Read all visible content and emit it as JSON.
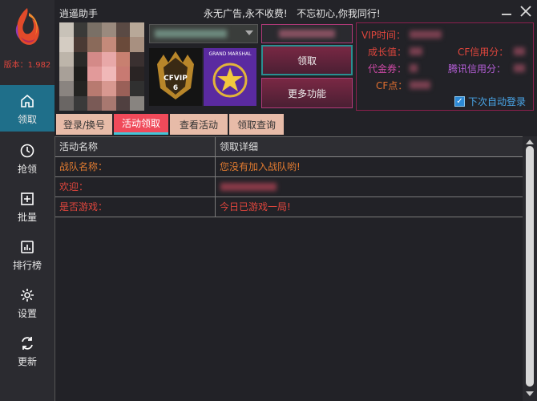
{
  "app": {
    "title": "逍遥助手",
    "slogan": "永无广告,永不收费!   不忘初心,你我同行!",
    "version": "版本：1.982"
  },
  "sidebar": {
    "items": [
      {
        "label": "领取",
        "icon": "home-icon",
        "active": true
      },
      {
        "label": "抢领",
        "icon": "clock-icon"
      },
      {
        "label": "批量",
        "icon": "plus-square-icon"
      },
      {
        "label": "排行榜",
        "icon": "bar-chart-icon"
      },
      {
        "label": "设置",
        "icon": "gear-icon"
      },
      {
        "label": "更新",
        "icon": "refresh-icon"
      }
    ]
  },
  "account": {
    "badge_vip": "CFVIP",
    "badge_vip_level": "6",
    "badge_marshal": "GRAND MARSHAL"
  },
  "buttons": {
    "claim": "领取",
    "more": "更多功能"
  },
  "info": {
    "vip_time_label": "VIP时间：",
    "growth_label": "成长值：",
    "cf_credit_label": "CF信用分：",
    "voucher_label": "代金券：",
    "tencent_credit_label": "腾讯信用分：",
    "cf_points_label": "CF点：",
    "auto_login_label": "下次自动登录",
    "auto_login_checked": true
  },
  "tabs": [
    {
      "label": "登录/换号"
    },
    {
      "label": "活动领取",
      "active": true
    },
    {
      "label": "查看活动"
    },
    {
      "label": "领取查询"
    }
  ],
  "table": {
    "columns": [
      "活动名称",
      "领取详细"
    ],
    "rows": [
      {
        "name": "战队名称：",
        "detail": "您没有加入战队哟!"
      },
      {
        "name": "欢迎：",
        "detail": ""
      },
      {
        "name": "是否游戏：",
        "detail": "今日已游戏一局!"
      }
    ]
  },
  "colors": {
    "accent_active": "#1f6f8a",
    "label_red": "#e0463d",
    "panel_border": "#8c1f4d",
    "tab_active": "#f04a5a"
  }
}
